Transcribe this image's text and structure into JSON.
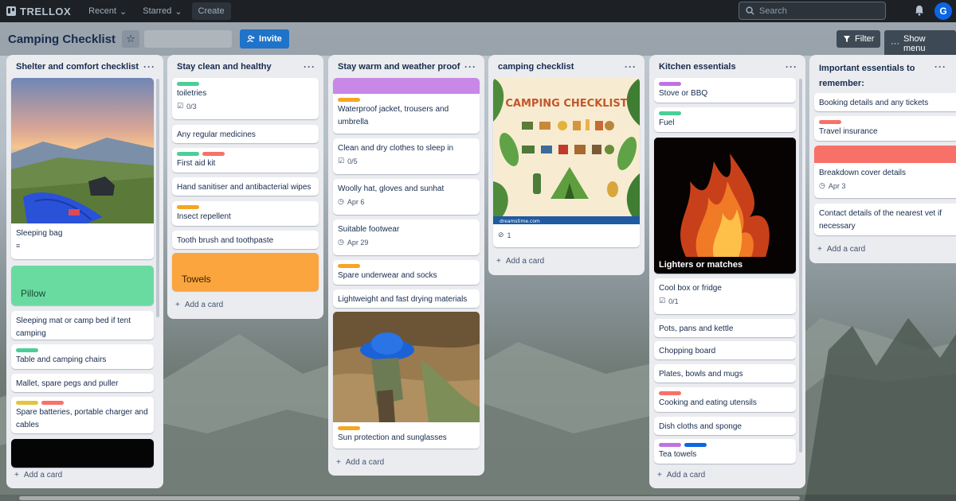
{
  "app": {
    "logo": "TRELLOX",
    "nav": [
      "Recent",
      "Starred"
    ],
    "create": "Create",
    "search_placeholder": "Search",
    "avatar_initial": "G"
  },
  "board": {
    "title": "Camping Checklist",
    "invite": "Invite",
    "filter": "Filter",
    "show_menu": "Show menu"
  },
  "colors": {
    "green": "#4bce97",
    "red": "#f87168",
    "orange": "#f5a623",
    "purple": "#c073e0",
    "yellow": "#e2c53d",
    "blue": "#0c66e4",
    "pillow": "#6adba0",
    "towels": "#faa53d",
    "breakdown": "#f87168",
    "lavender": "#c987e8"
  },
  "add_card": "Add a card",
  "lists": [
    {
      "title": "Shelter and comfort checklist",
      "cards": {
        "sleeping_bag": "Sleeping bag",
        "pillow": "Pillow",
        "sleeping_mat": "Sleeping mat or camp bed if tent camping",
        "chairs": "Table and camping chairs",
        "mallet": "Mallet, spare pegs and puller",
        "batteries": "Spare batteries, portable charger and cables"
      }
    },
    {
      "title": "Stay clean and healthy",
      "cards": {
        "toiletries": "toiletries",
        "toiletries_check": "0/3",
        "medicines": "Any regular medicines",
        "first_aid": "First aid kit",
        "sanitiser": "Hand sanitiser and antibacterial wipes",
        "insect": "Insect repellent",
        "toothbrush": "Tooth brush and toothpaste",
        "towels": "Towels"
      }
    },
    {
      "title": "Stay warm and weather proof",
      "cards": {
        "jacket": "Waterproof jacket, trousers and umbrella",
        "clothes": "Clean and dry clothes to sleep in",
        "clothes_check": "0/5",
        "hat": "Woolly hat, gloves and sunhat",
        "hat_date": "Apr 6",
        "footwear": "Suitable footwear",
        "footwear_date": "Apr 29",
        "underwear": "Spare underwear and socks",
        "lightweight": "Lightweight and fast drying materials",
        "sun": "Sun protection and sunglasses"
      }
    },
    {
      "title": "camping checklist",
      "cards": {
        "poster_title": "CAMPING CHECKLIST",
        "poster_credit": "dreamstime.com",
        "attachments": "1"
      }
    },
    {
      "title": "Kitchen essentials",
      "cards": {
        "stove": "Stove or BBQ",
        "fuel": "Fuel",
        "lighters": "Lighters or matches",
        "coolbox": "Cool box or fridge",
        "coolbox_check": "0/1",
        "pots": "Pots, pans and kettle",
        "chopping": "Chopping board",
        "plates": "Plates, bowls and mugs",
        "cooking": "Cooking and eating utensils",
        "dish": "Dish cloths and sponge",
        "tea": "Tea towels"
      }
    },
    {
      "title": "Important essentials to remember:",
      "cards": {
        "booking": "Booking details and any tickets",
        "insurance": "Travel insurance",
        "breakdown": "Breakdown cover details",
        "breakdown_date": "Apr 3",
        "vet": "Contact details of the nearest vet if necessary"
      }
    }
  ]
}
